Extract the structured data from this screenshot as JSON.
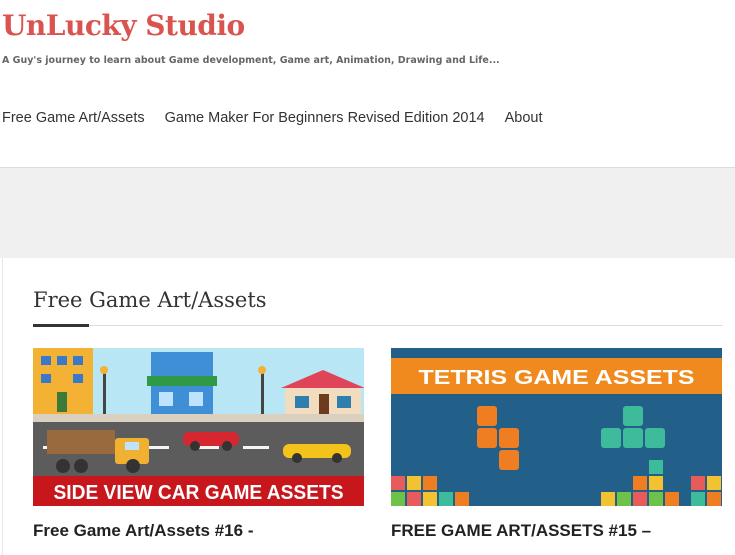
{
  "site": {
    "title": "UnLucky Studio",
    "tagline": "A Guy's journey to learn about Game development, Game art, Animation, Drawing and Life..."
  },
  "nav": {
    "items": [
      {
        "label": "Free Game Art/Assets"
      },
      {
        "label": "Game Maker For Beginners Revised Edition 2014"
      },
      {
        "label": "About"
      }
    ]
  },
  "section": {
    "title": "Free Game Art/Assets"
  },
  "posts": [
    {
      "title": "Free Game Art/Assets #16 -",
      "thumbnail_text": "SIDE VIEW CAR GAME ASSETS"
    },
    {
      "title": "FREE GAME ART/ASSETS #15 –",
      "thumbnail_text": "TETRIS GAME ASSETS"
    }
  ],
  "colors": {
    "brand": "#d9534f",
    "thumb1_banner": "#c8161d",
    "thumb2_banner": "#f08a1e",
    "thumb2_bg": "#22608a"
  }
}
